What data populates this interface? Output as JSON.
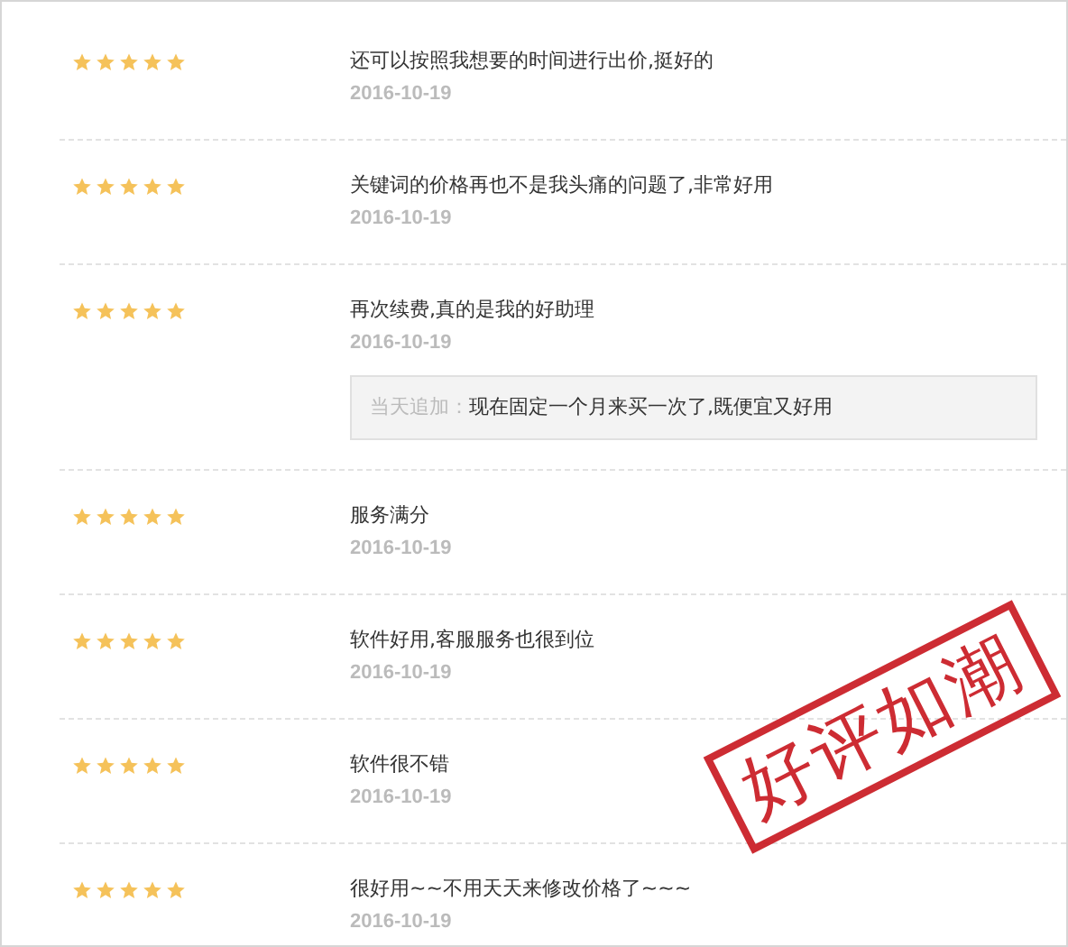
{
  "reviews": [
    {
      "stars": 5,
      "text": "还可以按照我想要的时间进行出价,挺好的",
      "date": "2016-10-19"
    },
    {
      "stars": 5,
      "text": "关键词的价格再也不是我头痛的问题了,非常好用",
      "date": "2016-10-19"
    },
    {
      "stars": 5,
      "text": "再次续费,真的是我的好助理",
      "date": "2016-10-19",
      "followup": {
        "label": "当天追加：",
        "text": "现在固定一个月来买一次了,既便宜又好用"
      }
    },
    {
      "stars": 5,
      "text": "服务满分",
      "date": "2016-10-19"
    },
    {
      "stars": 5,
      "text": "软件好用,客服服务也很到位",
      "date": "2016-10-19"
    },
    {
      "stars": 5,
      "text": "软件很不错",
      "date": "2016-10-19"
    },
    {
      "stars": 5,
      "text": "很好用~~不用天天来修改价格了~~~",
      "date": "2016-10-19"
    }
  ],
  "stamp": "好评如潮"
}
